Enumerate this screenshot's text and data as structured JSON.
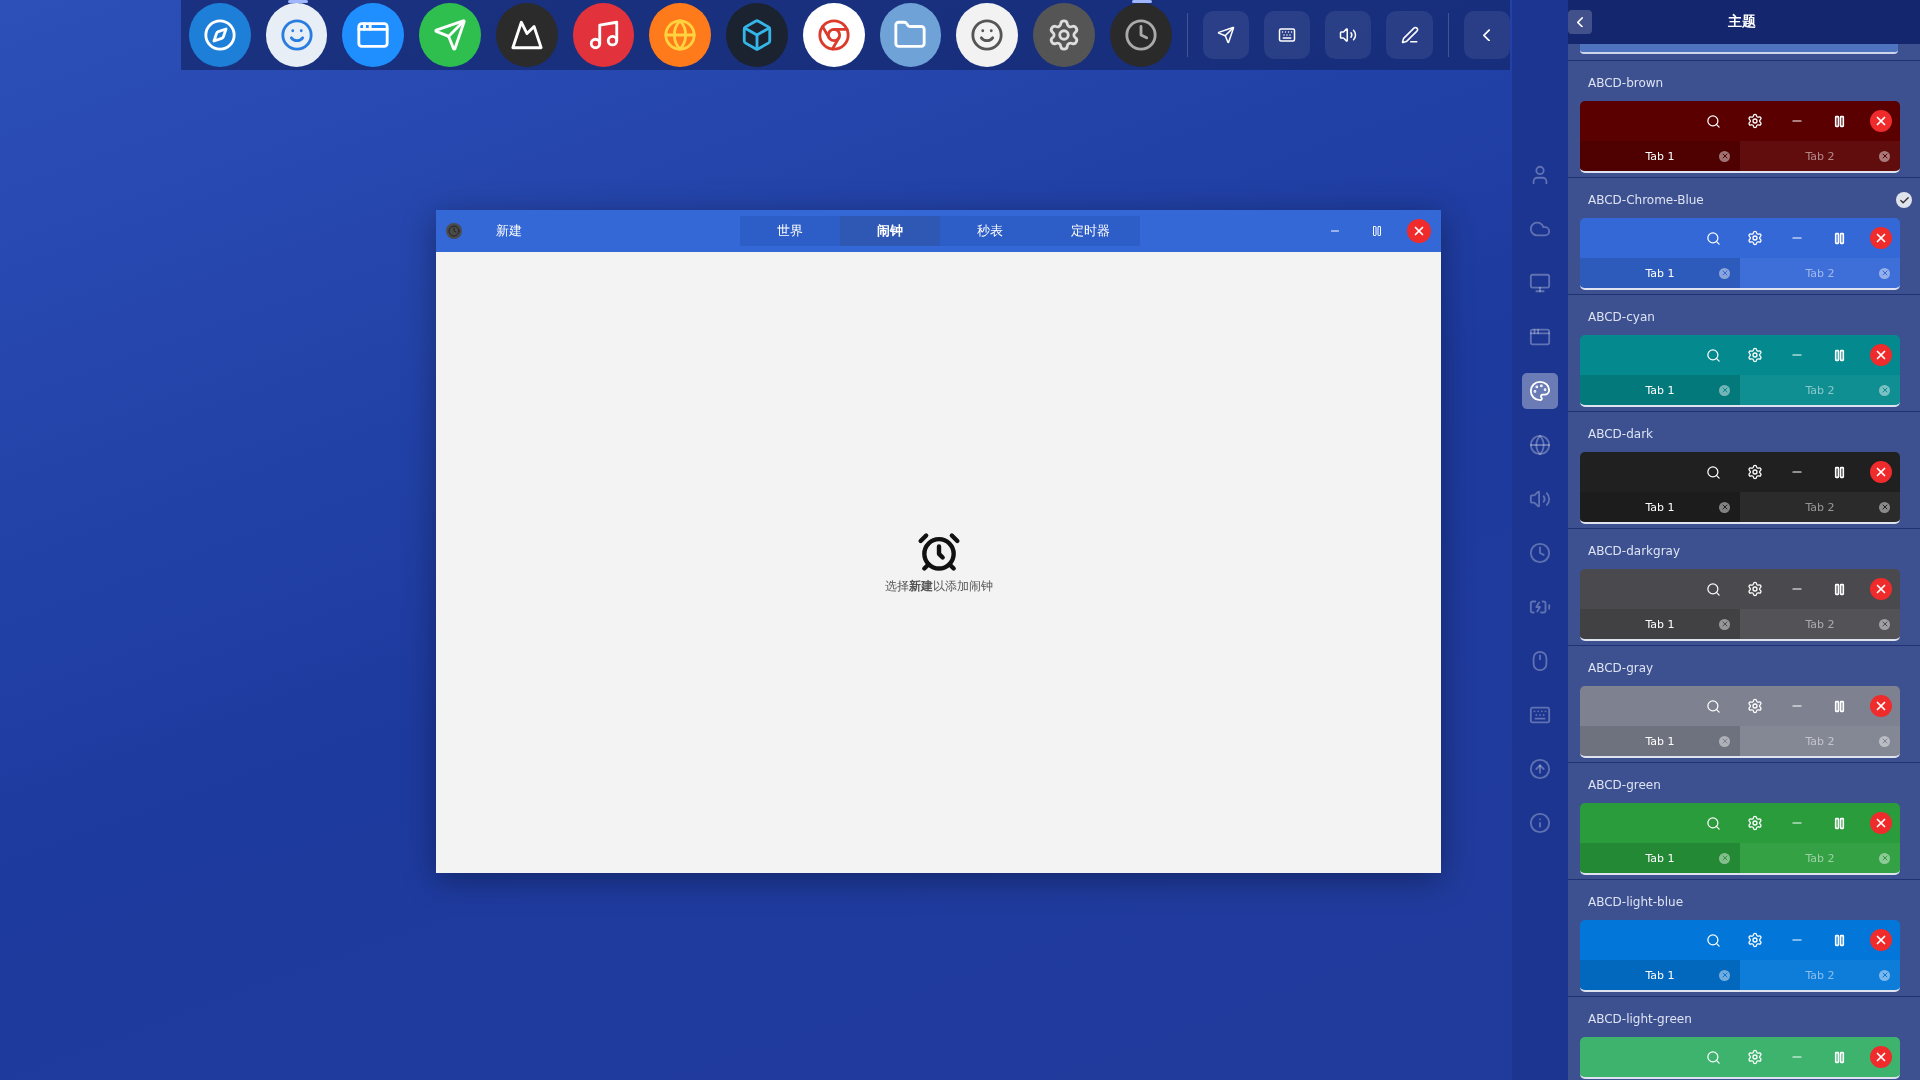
{
  "dock": {
    "apps": [
      {
        "running": false
      },
      {
        "running": true
      },
      {
        "running": false
      },
      {
        "running": false
      },
      {
        "running": false
      },
      {
        "running": false
      },
      {
        "running": false
      },
      {
        "running": false
      },
      {
        "running": false
      },
      {
        "running": false
      },
      {
        "running": false
      },
      {
        "running": false
      },
      {
        "running": true
      }
    ]
  },
  "window": {
    "new_button": "新建",
    "tabs": [
      {
        "label": "世界",
        "selected": false
      },
      {
        "label": "闹钟",
        "selected": true
      },
      {
        "label": "秒表",
        "selected": false
      },
      {
        "label": "定时器",
        "selected": false
      }
    ],
    "empty_message": "选择**新建**以添加闹钟"
  },
  "settings_sidebar": {
    "items": [
      {
        "selected": false
      },
      {
        "selected": false
      },
      {
        "selected": false
      },
      {
        "selected": false
      },
      {
        "selected": true
      },
      {
        "selected": false
      },
      {
        "selected": false
      },
      {
        "selected": false
      },
      {
        "selected": false
      },
      {
        "selected": false
      },
      {
        "selected": false
      },
      {
        "selected": false
      },
      {
        "selected": false
      }
    ]
  },
  "theme_panel": {
    "title": "主题",
    "themes": [
      {
        "name": "ABCD-brown",
        "color": "#5a0000",
        "selected": false,
        "tabs": [
          {
            "label": "Tab 1",
            "selected": true
          },
          {
            "label": "Tab 2",
            "selected": false
          }
        ]
      },
      {
        "name": "ABCD-Chrome-Blue",
        "color": "#3468d6",
        "selected": true,
        "tabs": [
          {
            "label": "Tab 1",
            "selected": true
          },
          {
            "label": "Tab 2",
            "selected": false
          }
        ]
      },
      {
        "name": "ABCD-cyan",
        "color": "#048a8e",
        "selected": false,
        "tabs": [
          {
            "label": "Tab 1",
            "selected": true
          },
          {
            "label": "Tab 2",
            "selected": false
          }
        ]
      },
      {
        "name": "ABCD-dark",
        "color": "#202020",
        "selected": false,
        "tabs": [
          {
            "label": "Tab 1",
            "selected": true
          },
          {
            "label": "Tab 2",
            "selected": false
          }
        ]
      },
      {
        "name": "ABCD-darkgray",
        "color": "#4a4a4e",
        "selected": false,
        "tabs": [
          {
            "label": "Tab 1",
            "selected": true
          },
          {
            "label": "Tab 2",
            "selected": false
          }
        ]
      },
      {
        "name": "ABCD-gray",
        "color": "#7e8290",
        "selected": false,
        "tabs": [
          {
            "label": "Tab 1",
            "selected": true
          },
          {
            "label": "Tab 2",
            "selected": false
          }
        ]
      },
      {
        "name": "ABCD-green",
        "color": "#2a9c3c",
        "selected": false,
        "tabs": [
          {
            "label": "Tab 1",
            "selected": true
          },
          {
            "label": "Tab 2",
            "selected": false
          }
        ]
      },
      {
        "name": "ABCD-light-blue",
        "color": "#0277d9",
        "selected": false,
        "tabs": [
          {
            "label": "Tab 1",
            "selected": true
          },
          {
            "label": "Tab 2",
            "selected": false
          }
        ]
      },
      {
        "name": "ABCD-light-green",
        "color": "#3db36e",
        "selected": false
      }
    ]
  }
}
